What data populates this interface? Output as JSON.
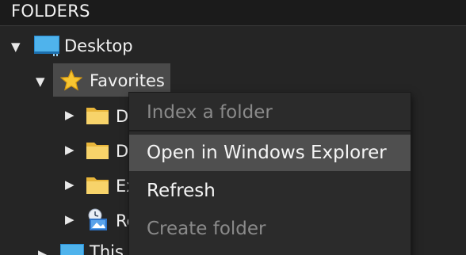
{
  "header": {
    "title": "FOLDERS"
  },
  "tree": {
    "desktop": {
      "label": "Desktop",
      "icon": "desktop-icon",
      "expanded": true
    },
    "favorites": {
      "label": "Favorites",
      "icon": "star-icon",
      "expanded": true,
      "selected": true
    },
    "children": [
      {
        "label": "D",
        "icon": "folder-icon"
      },
      {
        "label": "D",
        "icon": "folder-icon"
      },
      {
        "label": "Ex",
        "icon": "folder-icon"
      },
      {
        "label": "Re",
        "icon": "recent-places-icon"
      }
    ],
    "this_pc": {
      "label": "This",
      "icon": "computer-icon"
    }
  },
  "context_menu": {
    "items": [
      {
        "label": "Index a folder",
        "enabled": false
      },
      {
        "label": "Open in Windows Explorer",
        "enabled": true,
        "hover": true
      },
      {
        "label": "Refresh",
        "enabled": true
      },
      {
        "label": "Create folder",
        "enabled": false
      }
    ]
  },
  "colors": {
    "background": "#252525",
    "header_background": "#1b1b1b",
    "selection": "#4a4a4a",
    "menu_background": "#2b2b2b",
    "menu_hover": "#4f4f4f",
    "disabled_text": "#8a8a8a",
    "folder_yellow": "#f5c94c",
    "desktop_blue": "#3aa0e0",
    "star_yellow": "#f7c531"
  }
}
